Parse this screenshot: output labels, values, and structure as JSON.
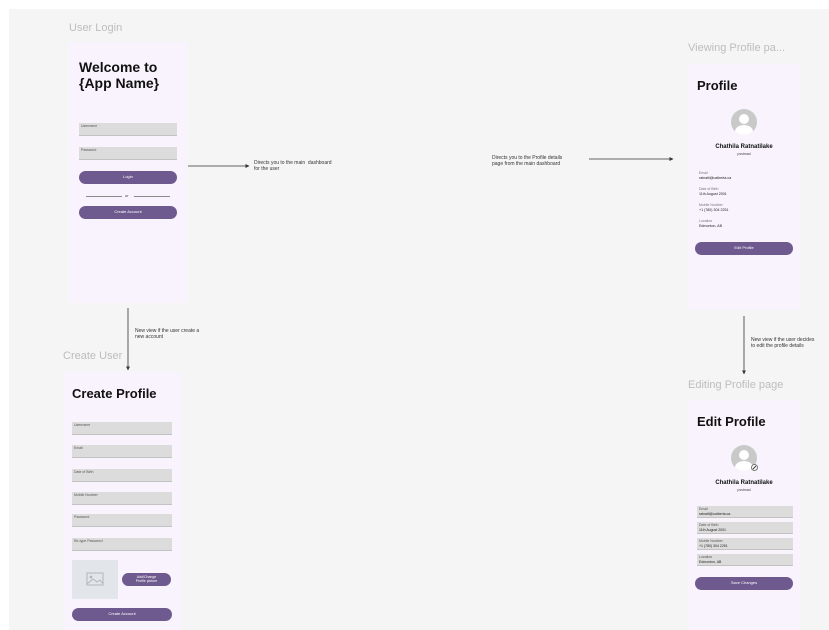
{
  "login": {
    "frame_label": "User Login",
    "title": "Welcome to\n{App Name}",
    "username_label": "Username",
    "password_label": "Password",
    "login_button": "Login",
    "or_text": "or",
    "create_account_button": "Create Account"
  },
  "create": {
    "frame_label": "Create User",
    "title": "Create Profile",
    "fields": [
      "Username",
      "Email",
      "Date of Birth",
      "Mobile Number",
      "Password",
      "Re-type Password"
    ],
    "image_button": "Add/Change\nProfile picture",
    "create_button": "Create Account"
  },
  "view": {
    "frame_label": "Viewing Profile pa...",
    "title": "Profile",
    "name": "Chathila Ratnatilake",
    "role": "psstmad",
    "email_label": "Email",
    "email_value": "ratnatil@ualberta.ca",
    "dob_label": "Date of Birth",
    "dob_value": "11th August 2001",
    "mobile_label": "Mobile Number",
    "mobile_value": "+1 (780) 304 2251",
    "location_label": "Location",
    "location_value": "Edmonton, AB",
    "edit_button": "Edit Profile"
  },
  "edit": {
    "frame_label": "Editing Profile page",
    "title": "Edit Profile",
    "name": "Chathila Ratnatilake",
    "role": "psstmad",
    "email_label": "Email",
    "email_value": "ratnatil@ualberta.ca",
    "dob_label": "Date of Birth",
    "dob_value": "11th August 2001",
    "mobile_label": "Mobile Number",
    "mobile_value": "+1 (780) 304 2251",
    "location_label": "Location",
    "location_value": "Edmonton, AB",
    "save_button": "Save Changes"
  },
  "notes": {
    "login_to_dashboard": "Directs you to the main  dashboard\nfor the user",
    "dashboard_to_profile": "Directs you to the Profile details\npage from the main dashboard",
    "login_to_create": "New view if the user create a\nnew account",
    "view_to_edit": "New view if the user decides\nto edit the profile details"
  },
  "colors": {
    "canvas": "#f5f5f5",
    "frame": "#f8f3fd",
    "button": "#6e5a8e",
    "field": "#dcdcdc",
    "frame_label": "#bdbdbd"
  }
}
